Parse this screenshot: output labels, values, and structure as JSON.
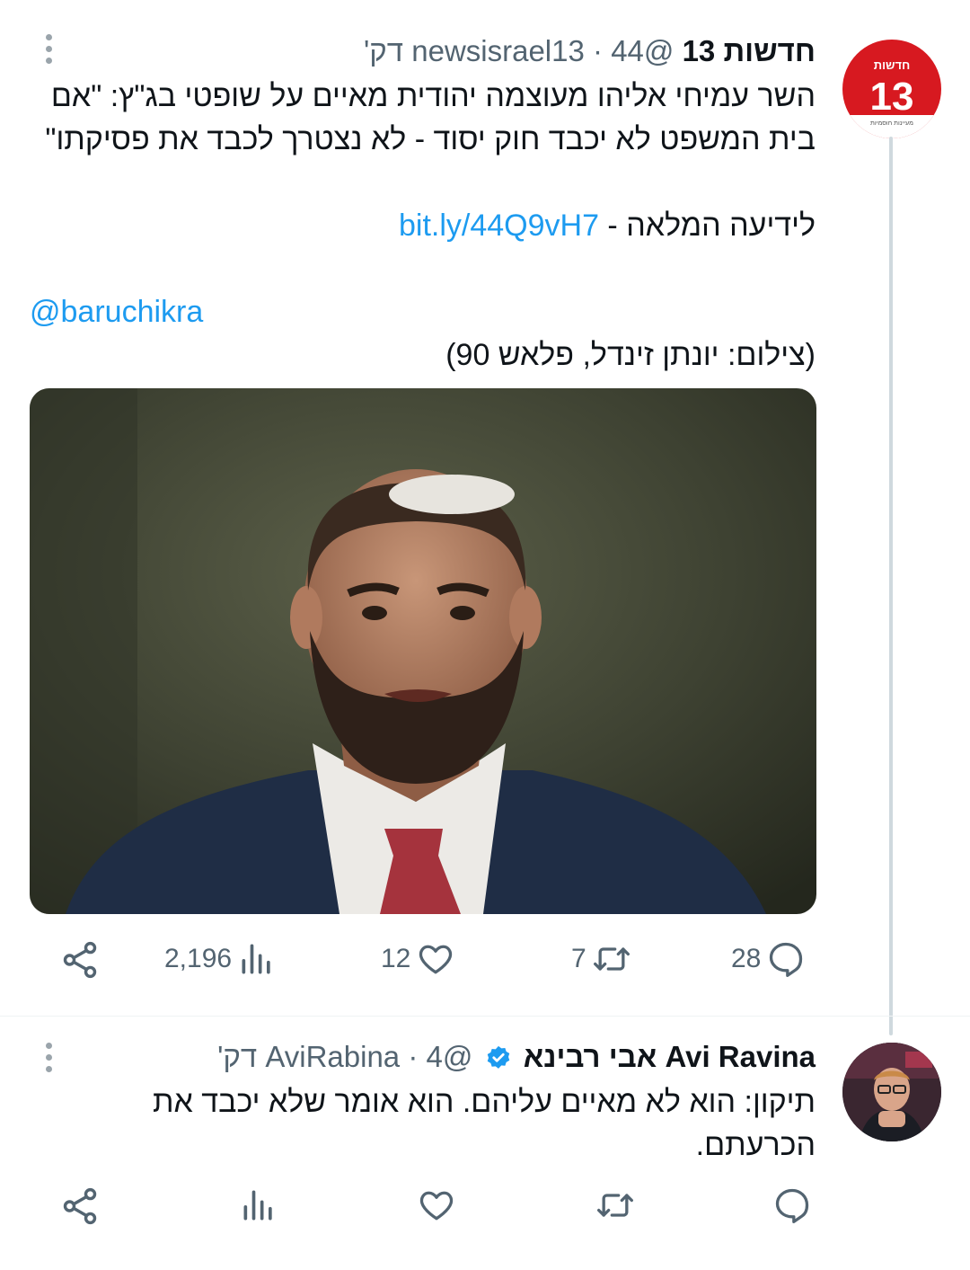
{
  "tweet1": {
    "avatar_logo": {
      "top": "חדשות",
      "number": "13",
      "tagline": "מעיינות חוסמיות"
    },
    "author_name": "חדשות 13",
    "handle": "@newsisrael13",
    "separator": "·",
    "time": "44 דק'",
    "text_line1": "השר עמיחי אליהו מעוצמה יהודית מאיים על שופטי בג\"ץ: \"אם",
    "text_line2": "בית המשפט לא יכבד חוק יסוד - לא נצטרך לכבד את פסיקתו\"",
    "link_prefix": "לידיעה המלאה - ",
    "link": "bit.ly/44Q9vH7",
    "mention": "@baruchikra",
    "credit": "(צילום: יונתן זינדל, פלאש 90)",
    "stats": {
      "replies": "28",
      "retweets": "7",
      "likes": "12",
      "views": "2,196"
    }
  },
  "tweet2": {
    "author_name": "Avi Ravina אבי רבינא",
    "handle": "@AviRabina",
    "separator": "·",
    "time": "4 דק'",
    "text_line1": "תיקון: הוא לא מאיים עליהם. הוא אומר שלא יכבד את",
    "text_line2": "הכרעתם."
  },
  "colors": {
    "accent": "#1d9bf0",
    "secondary_text": "#536471",
    "brand_red": "#d71920"
  },
  "icons": [
    "more-icon",
    "reply-icon",
    "retweet-icon",
    "like-icon",
    "views-icon",
    "share-icon",
    "verified-icon"
  ]
}
